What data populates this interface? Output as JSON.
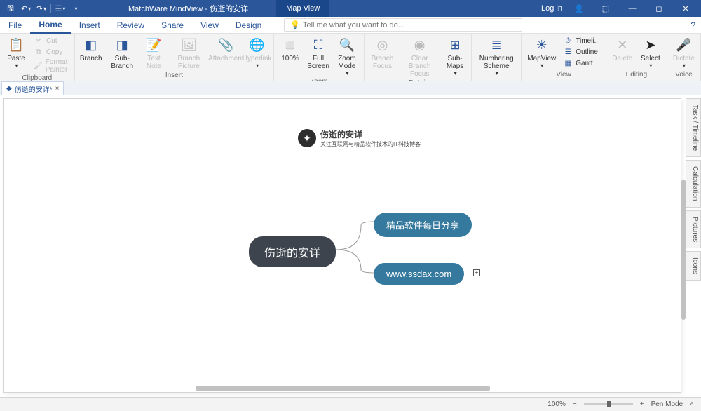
{
  "title": {
    "app": "MatchWare MindView - 伤逝的安详",
    "view_button": "Map View",
    "login": "Log in"
  },
  "menu": {
    "file": "File",
    "home": "Home",
    "insert": "Insert",
    "review": "Review",
    "share": "Share",
    "view": "View",
    "design": "Design"
  },
  "tellme": {
    "placeholder": "Tell me what you want to do..."
  },
  "ribbon": {
    "clipboard": {
      "label": "Clipboard",
      "paste": "Paste",
      "cut": "Cut",
      "copy": "Copy",
      "fmt": "Format Painter"
    },
    "insert": {
      "label": "Insert",
      "branch": "Branch",
      "subbranch": "Sub-Branch",
      "textnote": "Text\nNote",
      "branchpic": "Branch\nPicture",
      "attachment": "Attachment",
      "hyperlink": "Hyperlink"
    },
    "zoom": {
      "label": "Zoom",
      "pct": "100%",
      "fullscreen": "Full Screen",
      "zoommode": "Zoom\nMode"
    },
    "detail": {
      "label": "Detail",
      "branchfocus": "Branch Focus",
      "clearfocus": "Clear Branch\nFocus",
      "submaps": "Sub-Maps"
    },
    "numbering": {
      "label": "",
      "scheme": "Numbering\nScheme"
    },
    "view": {
      "label": "View",
      "mapview": "MapView",
      "timeline": "Timeli...",
      "outline": "Outline",
      "gantt": "Gantt"
    },
    "editing": {
      "label": "Editing",
      "delete": "Delete",
      "select": "Select"
    },
    "voice": {
      "label": "Voice",
      "dictate": "Dictate"
    }
  },
  "doctab": {
    "name": "伤逝的安详*"
  },
  "mindmap": {
    "root": "伤逝的安详",
    "sub1": "精品软件每日分享",
    "sub2": "www.ssdax.com"
  },
  "sidepanels": {
    "task": "Task / Timeline",
    "calc": "Calculation",
    "pics": "Pictures",
    "icons": "Icons"
  },
  "watermark": {
    "title": "伤逝的安详",
    "sub": "关注互联网与精品软件技术的IT科技博客"
  },
  "status": {
    "zoom": "100%",
    "pen": "Pen Mode"
  }
}
